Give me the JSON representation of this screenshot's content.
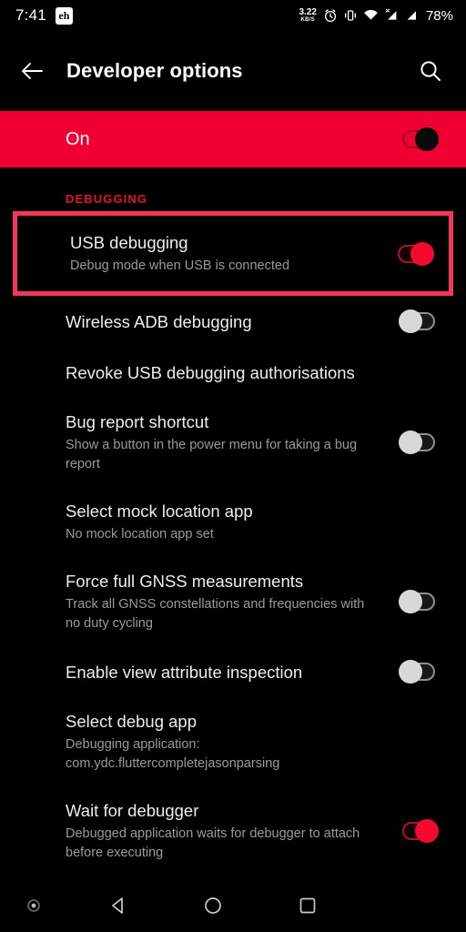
{
  "statusbar": {
    "time": "7:41",
    "app_badge": "eh",
    "network_speed_value": "3.22",
    "network_speed_unit": "KB/S",
    "icons": [
      "alarm-icon",
      "vibrate-icon",
      "wifi-icon",
      "signal-no-service-icon",
      "signal-icon"
    ],
    "battery": "78%"
  },
  "appbar": {
    "back_icon": "back-arrow-icon",
    "title": "Developer options",
    "search_icon": "search-icon"
  },
  "banner": {
    "label": "On",
    "toggle_state": "on"
  },
  "section": {
    "header": "DEBUGGING"
  },
  "colors": {
    "accent_red": "#F00032",
    "section_header_red": "#E8112D",
    "highlight_border": "#F4365C",
    "toggle_on": "#F40A2E",
    "toggle_off": "#D8D8D8",
    "background": "#000000",
    "primary_text": "#EDEDED",
    "secondary_text": "#9A9A9A"
  },
  "rows": [
    {
      "title": "USB debugging",
      "subtitle": "Debug mode when USB is connected",
      "control": "toggle",
      "state": "on",
      "highlighted": true
    },
    {
      "title": "Wireless ADB debugging",
      "subtitle": "",
      "control": "toggle",
      "state": "off",
      "highlighted": false
    },
    {
      "title": "Revoke USB debugging authorisations",
      "subtitle": "",
      "control": "none",
      "state": "",
      "highlighted": false
    },
    {
      "title": "Bug report shortcut",
      "subtitle": "Show a button in the power menu for taking a bug report",
      "control": "toggle",
      "state": "off",
      "highlighted": false
    },
    {
      "title": "Select mock location app",
      "subtitle": "No mock location app set",
      "control": "none",
      "state": "",
      "highlighted": false
    },
    {
      "title": "Force full GNSS measurements",
      "subtitle": "Track all GNSS constellations and frequencies with no duty cycling",
      "control": "toggle",
      "state": "off",
      "highlighted": false
    },
    {
      "title": "Enable view attribute inspection",
      "subtitle": "",
      "control": "toggle",
      "state": "off",
      "highlighted": false
    },
    {
      "title": "Select debug app",
      "subtitle": "Debugging application: com.ydc.fluttercompletejasonparsing",
      "control": "none",
      "state": "",
      "highlighted": false
    },
    {
      "title": "Wait for debugger",
      "subtitle": "Debugged application waits for debugger to attach before executing",
      "control": "toggle",
      "state": "on",
      "highlighted": false
    }
  ],
  "navbar": {
    "items": [
      "record-dot-icon",
      "back-triangle-icon",
      "home-circle-icon",
      "recents-square-icon"
    ]
  }
}
